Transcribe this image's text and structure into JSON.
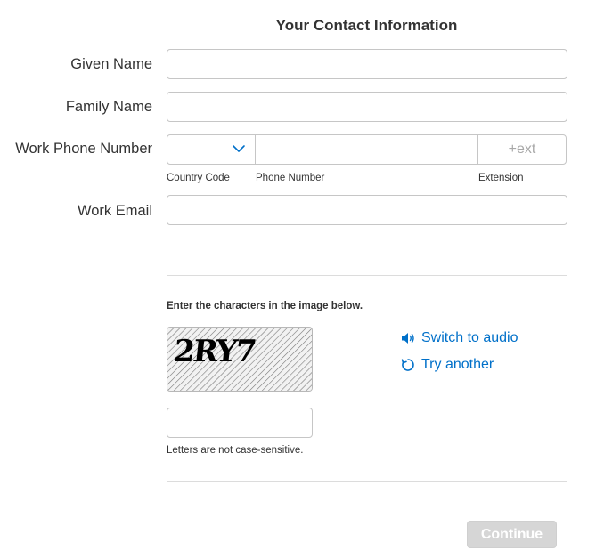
{
  "heading": "Your Contact Information",
  "fields": {
    "given_name": {
      "label": "Given Name",
      "value": ""
    },
    "family_name": {
      "label": "Family Name",
      "value": ""
    },
    "work_phone": {
      "label": "Work Phone Number",
      "country_code_label": "Country Code",
      "country_code_value": "",
      "phone_number_label": "Phone Number",
      "phone_number_value": "",
      "extension_label": "Extension",
      "extension_placeholder": "+ext"
    },
    "work_email": {
      "label": "Work Email",
      "value": ""
    }
  },
  "captcha": {
    "prompt": "Enter the characters in the image below.",
    "image_text": "2RY7",
    "switch_audio_label": "Switch to audio",
    "try_another_label": "Try another",
    "answer_value": "",
    "hint": "Letters are not case-sensitive."
  },
  "continue_label": "Continue",
  "colors": {
    "link": "#0070c9",
    "border": "#c6c6c6",
    "button_disabled_bg": "#d6d6d6",
    "text": "#333333"
  },
  "icons": {
    "country_dropdown": "chevron-down-icon",
    "audio": "speaker-icon",
    "refresh": "refresh-icon"
  }
}
